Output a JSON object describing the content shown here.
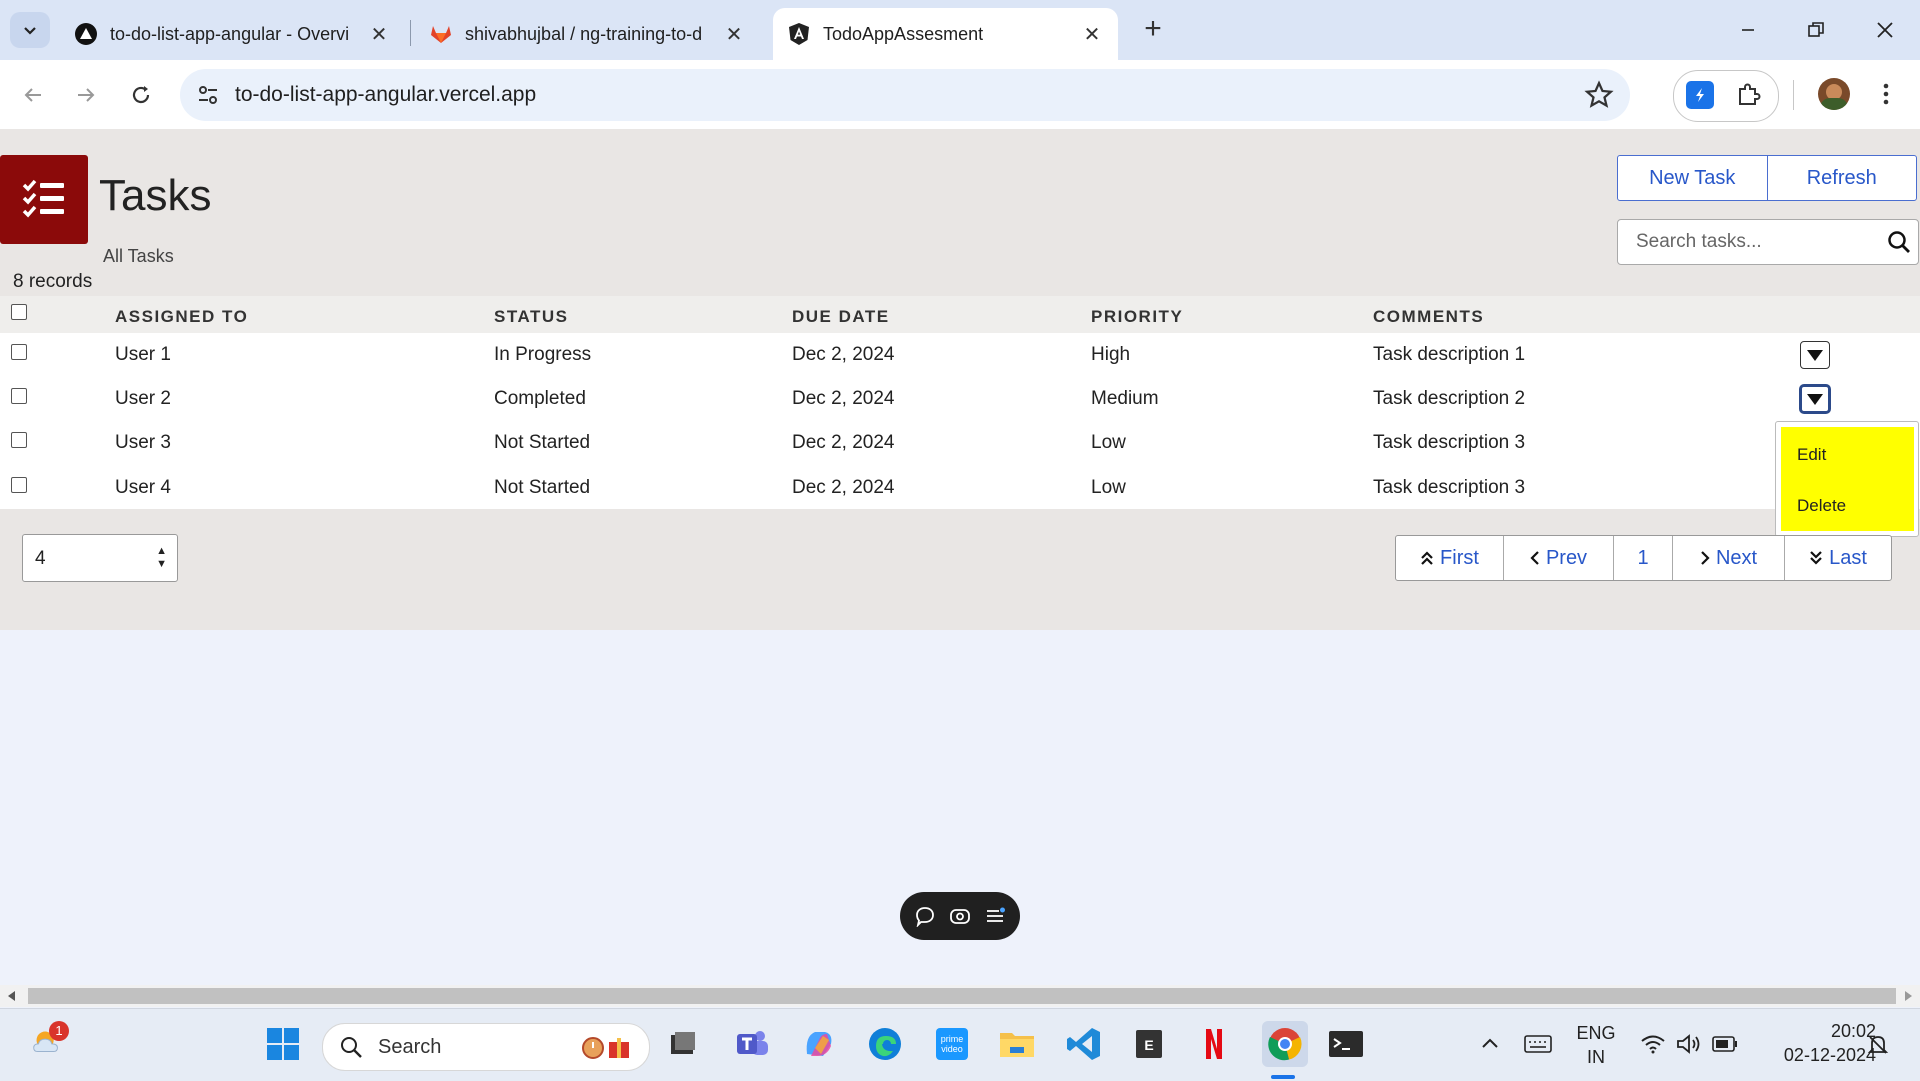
{
  "browser": {
    "tabs": [
      {
        "title": "to-do-list-app-angular - Overvi",
        "active": false,
        "icon": "vercel-icon"
      },
      {
        "title": "shivabhujbal / ng-training-to-d",
        "active": false,
        "icon": "gitlab-icon"
      },
      {
        "title": "TodoAppAssesment",
        "active": true,
        "icon": "angular-icon"
      }
    ],
    "url": "to-do-list-app-angular.vercel.app"
  },
  "app": {
    "title": "Tasks",
    "subtitle": "All Tasks",
    "records": "8 records",
    "buttons": {
      "new_task": "New Task",
      "refresh": "Refresh"
    },
    "search": {
      "placeholder": "Search tasks..."
    },
    "columns": [
      "ASSIGNED TO",
      "STATUS",
      "DUE DATE",
      "PRIORITY",
      "COMMENTS"
    ],
    "rows": [
      {
        "assigned_to": "User 1",
        "status": "In Progress",
        "due_date": "Dec 2, 2024",
        "priority": "High",
        "comments": "Task description 1"
      },
      {
        "assigned_to": "User 2",
        "status": "Completed",
        "due_date": "Dec 2, 2024",
        "priority": "Medium",
        "comments": "Task description 2"
      },
      {
        "assigned_to": "User 3",
        "status": "Not Started",
        "due_date": "Dec 2, 2024",
        "priority": "Low",
        "comments": "Task description 3"
      },
      {
        "assigned_to": "User 4",
        "status": "Not Started",
        "due_date": "Dec 2, 2024",
        "priority": "Low",
        "comments": "Task description 3"
      }
    ],
    "row_menu": {
      "edit": "Edit",
      "delete": "Delete"
    },
    "page_size": "4",
    "pager": {
      "first": "First",
      "prev": "Prev",
      "current": "1",
      "next": "Next",
      "last": "Last"
    },
    "colors": {
      "logo": "#8b0a0a",
      "link": "#2857c9",
      "menu_highlight": "#ffff00"
    }
  },
  "taskbar": {
    "search": "Search",
    "weather_badge": "1",
    "lang": "ENG",
    "region": "IN",
    "time": "20:02",
    "date": "02-12-2024"
  }
}
